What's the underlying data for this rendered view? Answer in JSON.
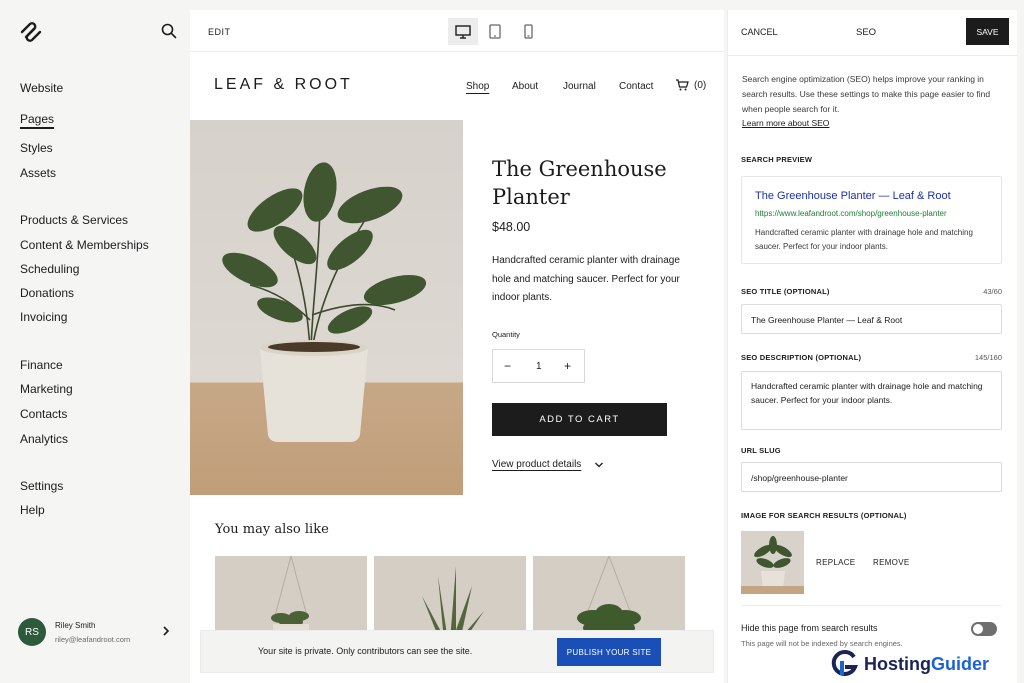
{
  "sidebar": {
    "items_group1": [
      {
        "label": "Website"
      },
      {
        "label": "Pages"
      },
      {
        "label": "Styles"
      },
      {
        "label": "Assets"
      }
    ],
    "items_group2": [
      {
        "label": "Products & Services"
      },
      {
        "label": "Content & Memberships"
      },
      {
        "label": "Scheduling"
      },
      {
        "label": "Donations"
      },
      {
        "label": "Invoicing"
      }
    ],
    "items_group3": [
      {
        "label": "Finance"
      },
      {
        "label": "Marketing"
      },
      {
        "label": "Contacts"
      },
      {
        "label": "Analytics"
      }
    ],
    "items_group4": [
      {
        "label": "Settings"
      },
      {
        "label": "Help"
      }
    ],
    "active": "Pages",
    "user": {
      "initials": "RS",
      "name": "Riley Smith",
      "email": "riley@leafandroot.com",
      "avatar_color": "#2e5a3c"
    }
  },
  "editor": {
    "edit_label": "EDIT",
    "device_active": "desktop"
  },
  "site": {
    "brand": "LEAF & ROOT",
    "nav": [
      {
        "label": "Shop"
      },
      {
        "label": "About"
      },
      {
        "label": "Journal"
      },
      {
        "label": "Contact"
      }
    ],
    "nav_active": "Shop",
    "cart_count": "(0)",
    "product": {
      "title": "The Greenhouse Planter",
      "price": "$48.00",
      "description": "Handcrafted ceramic planter with drainage hole and matching saucer. Perfect for your indoor plants.",
      "quantity_label": "Quantity",
      "quantity": "1",
      "add_to_cart": "ADD TO CART",
      "details_link": "View product details"
    },
    "also_like": "You may also like",
    "notice": {
      "text": "Your site is private. Only contributors can see the site.",
      "publish": "PUBLISH YOUR SITE"
    }
  },
  "seo_panel": {
    "cancel": "CANCEL",
    "title": "SEO",
    "save": "SAVE",
    "intro": "Search engine optimization (SEO) helps improve your ranking in search results. Use these settings to make this page easier to find when people search for it.",
    "learn_more": "Learn more about SEO",
    "preview_label": "SEARCH PREVIEW",
    "preview": {
      "title": "The Greenhouse Planter — Leaf & Root",
      "url": "https://www.leafandroot.com/shop/greenhouse-planter",
      "description": "Handcrafted ceramic planter with drainage hole and matching saucer. Perfect for your indoor plants."
    },
    "seo_title_label": "SEO TITLE (OPTIONAL)",
    "seo_title_count": "43/60",
    "seo_title_value": "The Greenhouse Planter — Leaf & Root",
    "seo_desc_label": "SEO DESCRIPTION (OPTIONAL)",
    "seo_desc_count": "145/160",
    "seo_desc_value": "Handcrafted ceramic planter with drainage hole and matching saucer. Perfect for your indoor plants.",
    "slug_label": "URL SLUG",
    "slug_value": "/shop/greenhouse-planter",
    "image_label": "IMAGE FOR SEARCH RESULTS (OPTIONAL)",
    "replace": "REPLACE",
    "remove": "REMOVE",
    "hide_title": "Hide this page from search results",
    "hide_sub": "This page will not be indexed by search engines.",
    "hide_enabled": false
  },
  "watermark": {
    "prefix": "Hosting",
    "suffix": "Guider"
  },
  "colors": {
    "accent": "#1b4fb8",
    "dark": "#1c1c1c",
    "link": "#1a2fb3",
    "url_green": "#1e7e34"
  }
}
